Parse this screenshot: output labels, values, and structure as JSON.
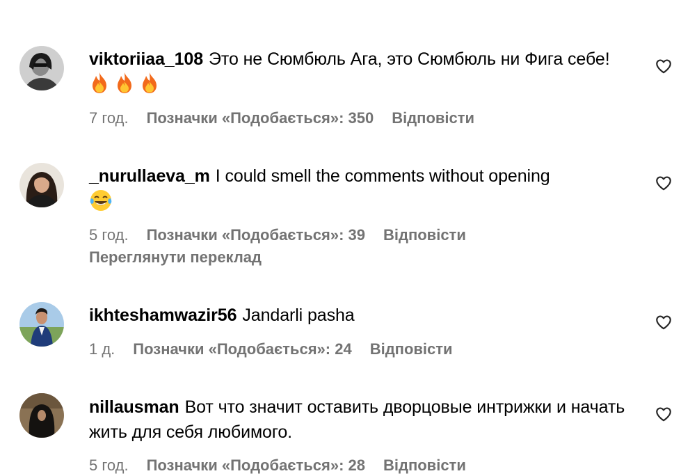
{
  "comments": [
    {
      "username": "viktoriiaa_108",
      "text": "Это не Сюмбюль Ага, это Сюмбюль ни Фига себе!",
      "emoji_count": 3,
      "emoji": "fire-emoji",
      "time": "7 год.",
      "likes": "Позначки «Подобається»: 350",
      "reply": "Відповісти",
      "avatar": "viktoriiaa-avatar"
    },
    {
      "username": "_nurullaeva_m",
      "text": "I could smell the comments without opening",
      "emoji_count": 1,
      "emoji": "tears-of-joy-emoji",
      "time": "5 год.",
      "likes": "Позначки «Подобається»: 39",
      "reply": "Відповісти",
      "translation": "Переглянути переклад",
      "avatar": "nurullaeva-avatar"
    },
    {
      "username": "ikhteshamwazir56",
      "text": "Jandarli pasha",
      "time": "1 д.",
      "likes": "Позначки «Подобається»: 24",
      "reply": "Відповісти",
      "avatar": "ikhteshamwazir-avatar"
    },
    {
      "username": "nillausman",
      "text": "Вот что значит оставить дворцовые интрижки и начать жить для себя любимого.",
      "time": "5 год.",
      "likes": "Позначки «Подобається»: 28",
      "reply": "Відповісти",
      "avatar": "nillausman-avatar"
    }
  ],
  "icons": {
    "like": "heart-outline-icon"
  },
  "colors": {
    "text": "#000000",
    "secondary": "#737373",
    "background": "#ffffff"
  }
}
